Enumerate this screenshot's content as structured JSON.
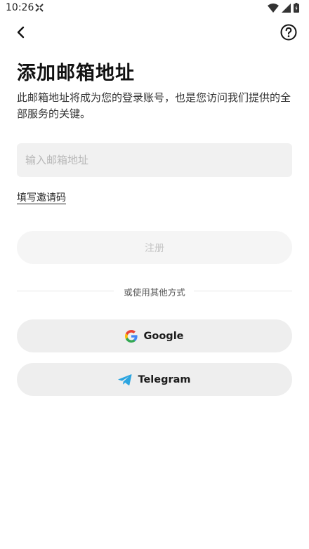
{
  "status_bar": {
    "time": "10:26"
  },
  "header": {
    "back_icon": "chevron-left-icon",
    "help_icon": "question-circle-icon"
  },
  "page": {
    "title": "添加邮箱地址",
    "subtitle": "此邮箱地址将成为您的登录账号，也是您访问我们提供的全部服务的关键。"
  },
  "form": {
    "email_placeholder": "输入邮箱地址",
    "email_value": "",
    "invite_link": "填写邀请码",
    "register_label": "注册"
  },
  "divider": {
    "label": "或使用其他方式"
  },
  "social": {
    "google_label": "Google",
    "telegram_label": "Telegram"
  },
  "colors": {
    "input_bg": "#f1f1f1",
    "register_bg": "#f5f5f5",
    "register_text": "#c5c5c5",
    "social_bg": "#eeeeee",
    "telegram_blue": "#2ca5e0"
  }
}
